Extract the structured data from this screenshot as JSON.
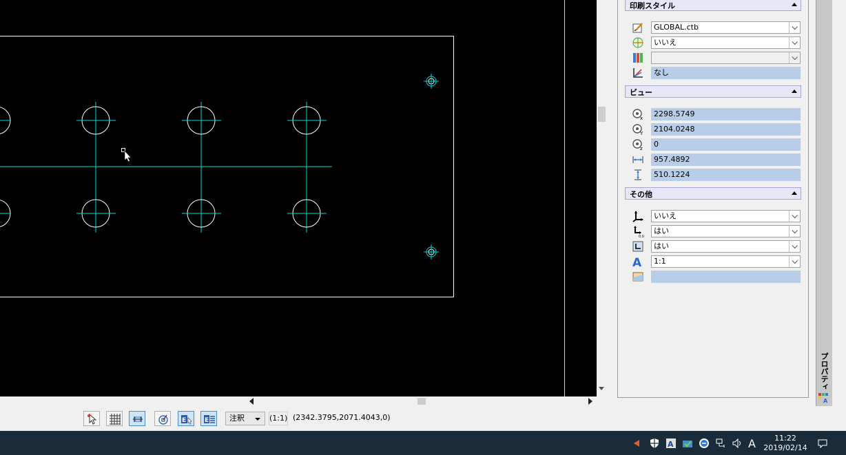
{
  "palette": {
    "title": "プロパティ",
    "sections": {
      "plot_style": {
        "title": "印刷スタイル",
        "rows": [
          {
            "icon": "plot-style-icon",
            "value": "GLOBAL.ctb"
          },
          {
            "icon": "plot-display-icon",
            "value": "いいえ"
          },
          {
            "icon": "plot-table-icon",
            "value": ""
          },
          {
            "icon": "plot-type-icon",
            "value": "なし"
          }
        ]
      },
      "view": {
        "title": "ビュー",
        "rows": [
          {
            "icon": "center-x-icon",
            "value": "2298.5749"
          },
          {
            "icon": "center-y-icon",
            "value": "2104.0248"
          },
          {
            "icon": "center-z-icon",
            "value": "0"
          },
          {
            "icon": "width-icon",
            "value": "957.4892"
          },
          {
            "icon": "height-icon",
            "value": "510.1224"
          }
        ]
      },
      "misc": {
        "title": "その他",
        "rows": [
          {
            "icon": "ucs-icon-on-icon",
            "value": "いいえ"
          },
          {
            "icon": "ucs-origin-icon",
            "value": "はい"
          },
          {
            "icon": "ucs-per-viewport-icon",
            "value": "はい"
          },
          {
            "icon": "annotation-scale-icon",
            "value": "1:1"
          },
          {
            "icon": "visual-style-icon",
            "value": ""
          }
        ]
      }
    }
  },
  "statusbar": {
    "annotation_label": "注釈",
    "scale": "(1:1)",
    "coordinates": "(2342.3795,2071.4043,0)"
  },
  "taskbar": {
    "time": "11:22",
    "date": "2019/02/14",
    "ime": "A"
  },
  "colors": {
    "canvas_bg": "#000000",
    "geometry_white": "#ffffff",
    "centerline_cyan": "#00d8d8",
    "readonly_field": "#b8cde8",
    "section_header": "#e6e8f8"
  }
}
